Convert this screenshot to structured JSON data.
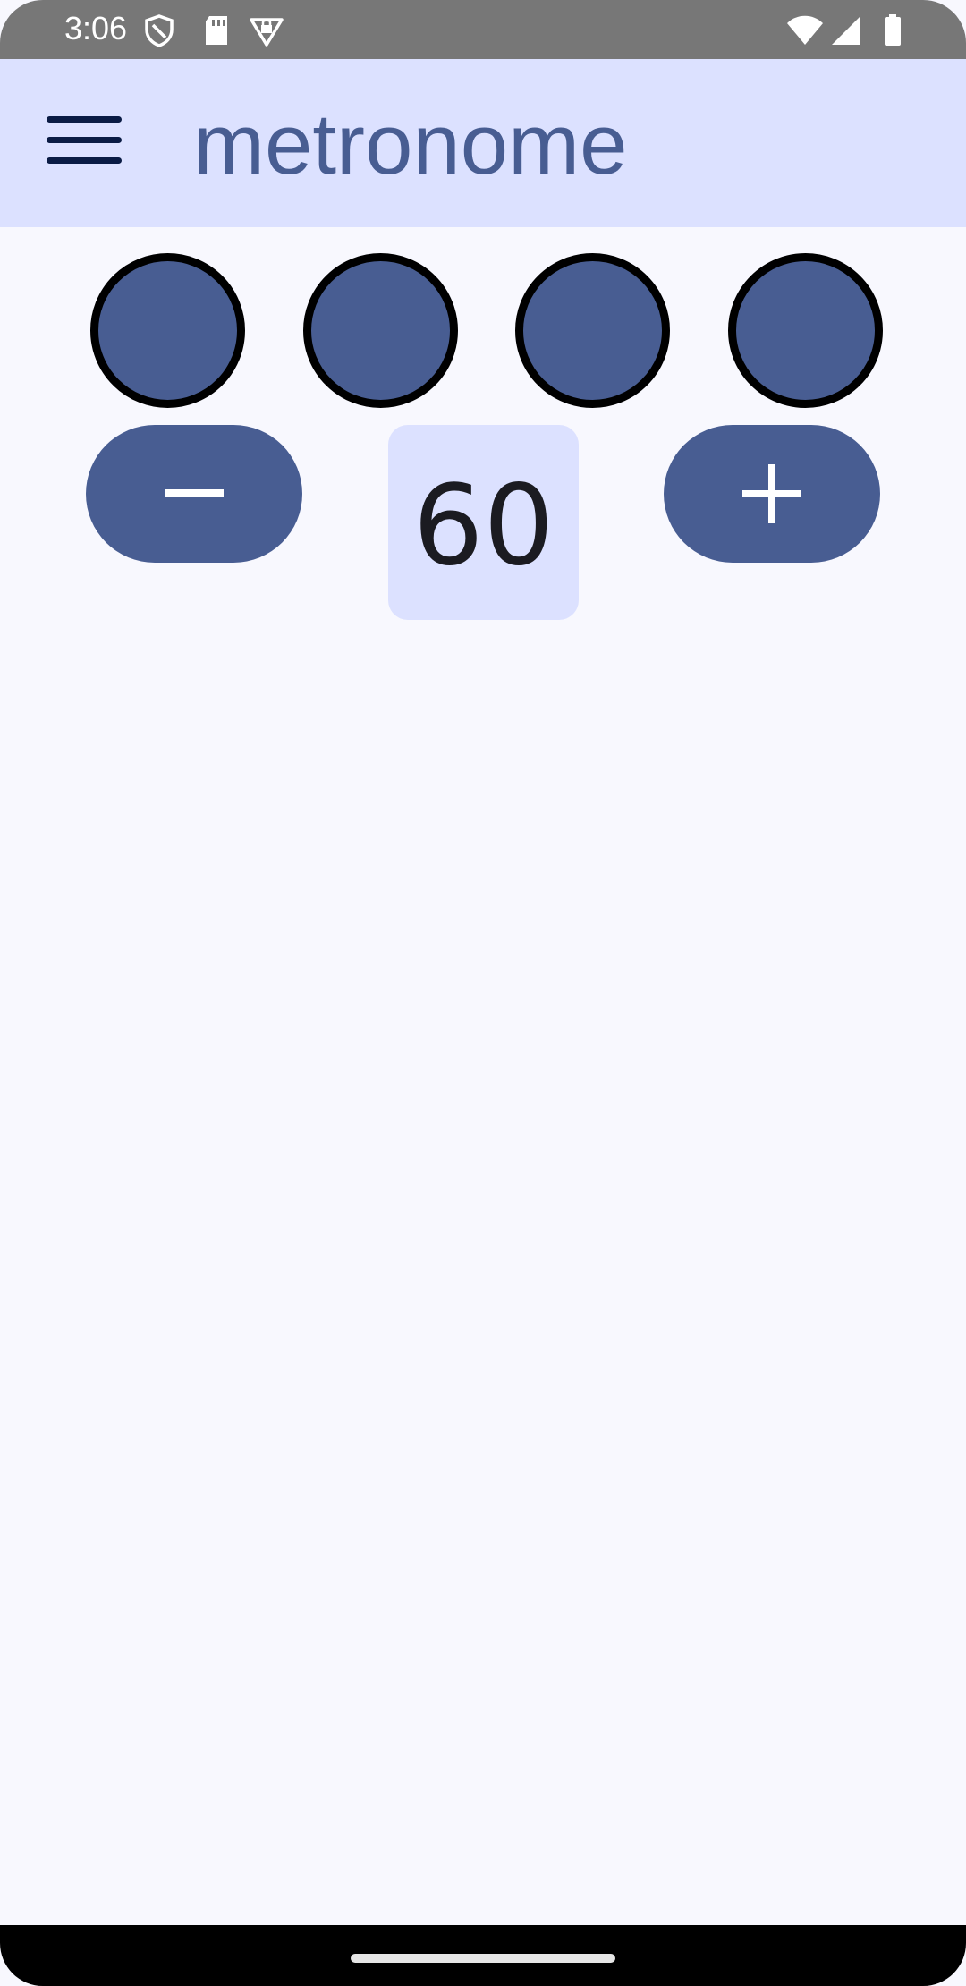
{
  "status_bar": {
    "time": "3:06",
    "icons": [
      "shield-icon",
      "sd-card-icon",
      "vpn-key-icon",
      "wifi-icon",
      "cell-signal-icon",
      "battery-icon"
    ]
  },
  "app_bar": {
    "title": "metronome",
    "menu_icon": "hamburger-menu-icon"
  },
  "beats": [
    {
      "name": "beat-1"
    },
    {
      "name": "beat-2"
    },
    {
      "name": "beat-3"
    },
    {
      "name": "beat-4"
    }
  ],
  "controls": {
    "decrease_icon": "minus-icon",
    "increase_icon": "plus-icon",
    "tempo": "60"
  },
  "colors": {
    "primary": "#485D92",
    "primary_container": "#DCE1FF",
    "background": "#F8F8FE",
    "on_surface": "#1B1B21",
    "outline": "#000000"
  }
}
